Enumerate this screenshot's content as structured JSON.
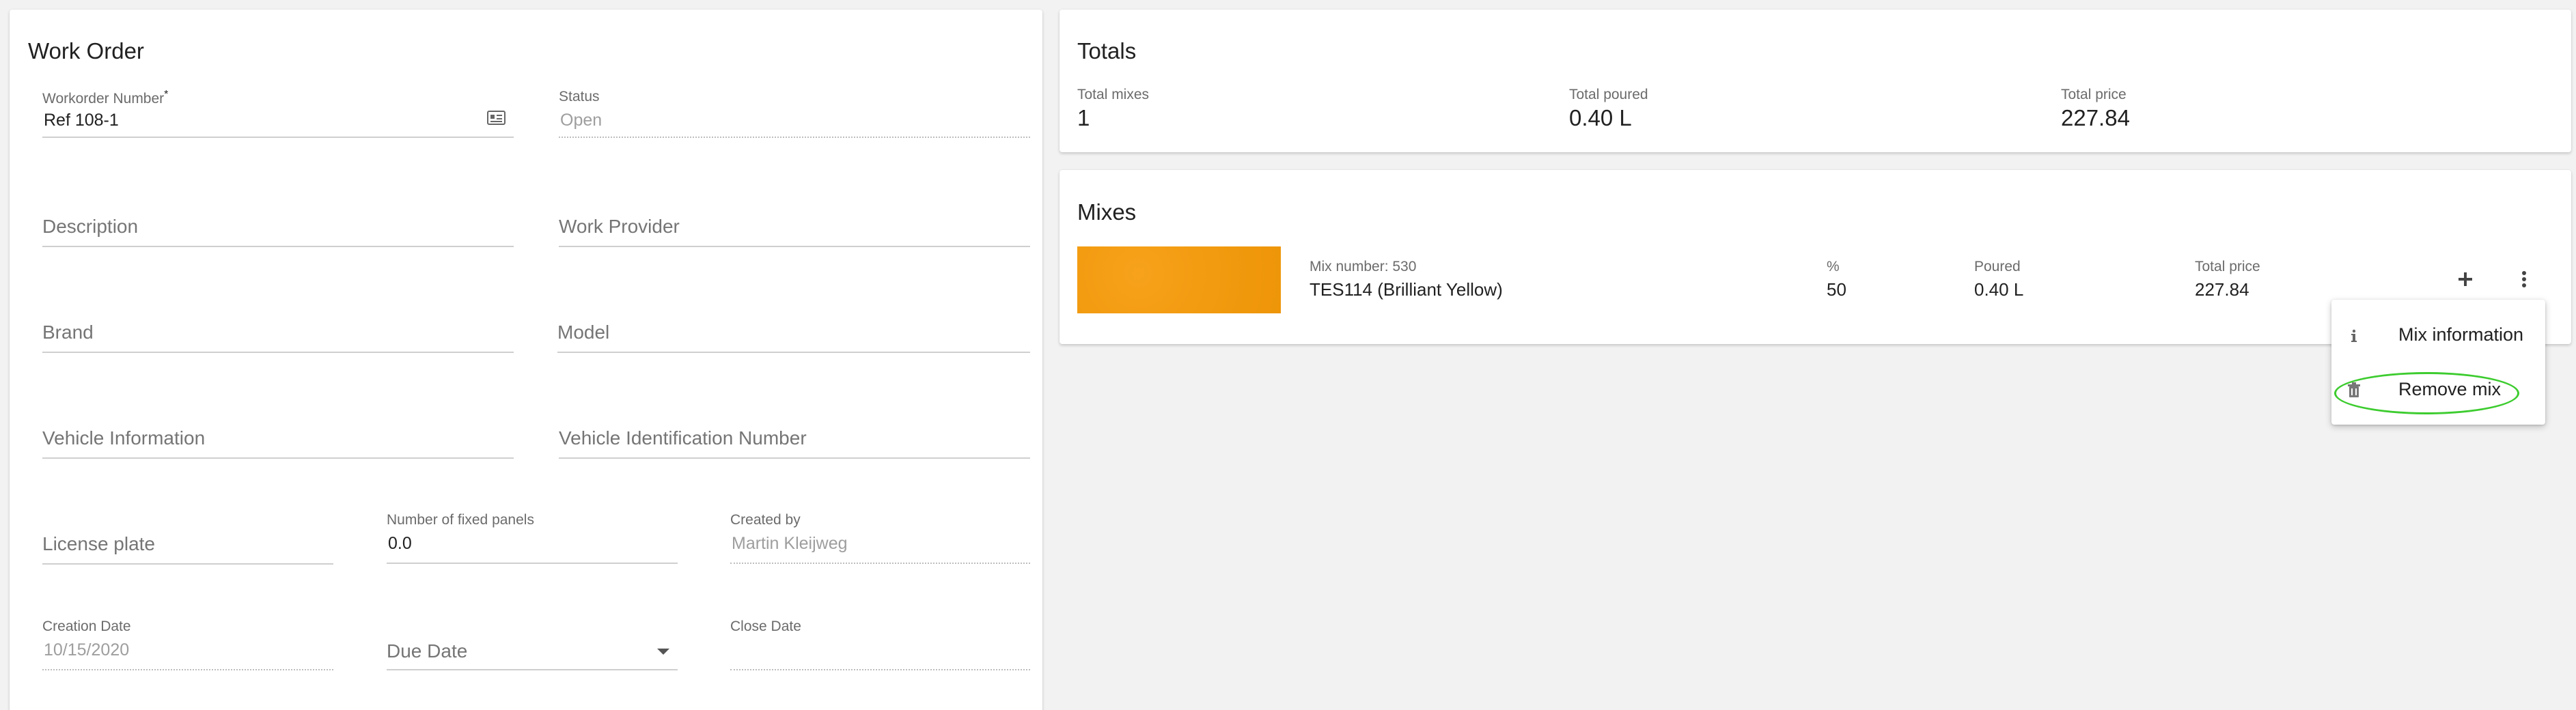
{
  "work_order": {
    "title": "Work Order",
    "workorder_number": {
      "label": "Workorder Number",
      "required_mark": "*",
      "value": "Ref 108-1"
    },
    "status": {
      "label": "Status",
      "value": "Open"
    },
    "description": {
      "placeholder": "Description"
    },
    "work_provider": {
      "placeholder": "Work Provider"
    },
    "brand": {
      "placeholder": "Brand"
    },
    "model": {
      "placeholder": "Model"
    },
    "vehicle_information": {
      "placeholder": "Vehicle Information"
    },
    "vin": {
      "placeholder": "Vehicle Identification Number"
    },
    "license_plate": {
      "placeholder": "License plate"
    },
    "fixed_panels": {
      "label": "Number of fixed panels",
      "value": "0.0"
    },
    "created_by": {
      "label": "Created by",
      "value": "Martin Kleijweg"
    },
    "creation_date": {
      "label": "Creation Date",
      "value": "10/15/2020"
    },
    "due_date": {
      "placeholder": "Due Date"
    },
    "close_date": {
      "label": "Close Date",
      "value": ""
    }
  },
  "totals": {
    "title": "Totals",
    "total_mixes": {
      "label": "Total mixes",
      "value": "1"
    },
    "total_poured": {
      "label": "Total poured",
      "value": "0.40 L"
    },
    "total_price": {
      "label": "Total price",
      "value": "227.84"
    }
  },
  "mixes": {
    "title": "Mixes",
    "items": [
      {
        "swatch_color": "#f39c12",
        "mix_number_label": "Mix number: 530",
        "name": "TES114 (Brilliant Yellow)",
        "percent_label": "%",
        "percent_value": "50",
        "poured_label": "Poured",
        "poured_value": "0.40 L",
        "price_label": "Total price",
        "price_value": "227.84",
        "add_icon": "plus-icon",
        "more_icon": "more-vert-icon"
      }
    ]
  },
  "context_menu": {
    "items": [
      {
        "label": "Mix information",
        "icon": "info-icon"
      },
      {
        "label": "Remove mix",
        "icon": "trash-icon"
      }
    ]
  },
  "colors": {
    "background": "#f2f2f2",
    "card": "#ffffff",
    "annotation_circle": "#3dcc2f"
  }
}
